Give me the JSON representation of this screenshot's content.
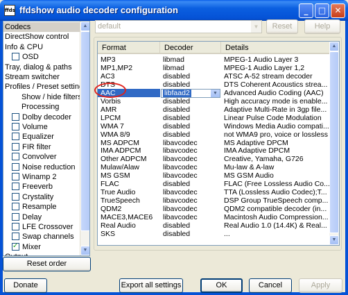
{
  "window": {
    "title": "ffdshow audio decoder configuration",
    "icon_label": "ffds"
  },
  "titlebar_buttons": {
    "minimize": "_",
    "maximize": "□",
    "close": "✕"
  },
  "tree": {
    "items": [
      {
        "label": "Codecs",
        "selected": true
      },
      {
        "label": "DirectShow control"
      },
      {
        "label": "Info & CPU"
      },
      {
        "label": "OSD",
        "checkbox": true,
        "checked": false
      },
      {
        "label": "Tray, dialog & paths"
      },
      {
        "label": "Stream switcher"
      },
      {
        "label": "Profiles / Preset settings"
      },
      {
        "label": "Show / hide filters"
      },
      {
        "label": "Processing"
      },
      {
        "label": "Dolby decoder",
        "checkbox": true,
        "checked": false
      },
      {
        "label": "Volume",
        "checkbox": true,
        "checked": false
      },
      {
        "label": "Equalizer",
        "checkbox": true,
        "checked": false
      },
      {
        "label": "FIR filter",
        "checkbox": true,
        "checked": false
      },
      {
        "label": "Convolver",
        "checkbox": true,
        "checked": false
      },
      {
        "label": "Noise reduction",
        "checkbox": true,
        "checked": false
      },
      {
        "label": "Winamp 2",
        "checkbox": true,
        "checked": false
      },
      {
        "label": "Freeverb",
        "checkbox": true,
        "checked": false
      },
      {
        "label": "Crystality",
        "checkbox": true,
        "checked": false
      },
      {
        "label": "Resample",
        "checkbox": true,
        "checked": false
      },
      {
        "label": "Delay",
        "checkbox": true,
        "checked": false
      },
      {
        "label": "LFE Crossover",
        "checkbox": true,
        "checked": false
      },
      {
        "label": "Swap channels",
        "checkbox": true,
        "checked": false
      },
      {
        "label": "Mixer",
        "checkbox": true,
        "checked": true
      },
      {
        "label": "Output"
      }
    ]
  },
  "preset": {
    "value": "default",
    "reset_label": "Reset",
    "help_label": "Help"
  },
  "codecs_table": {
    "headers": [
      "Format",
      "Decoder",
      "Details"
    ],
    "rows": [
      [
        "MP3",
        "libmad",
        "MPEG-1 Audio Layer 3"
      ],
      [
        "MP1,MP2",
        "libmad",
        "MPEG-1 Audio Layer 1,2"
      ],
      [
        "AC3",
        "disabled",
        "ATSC A-52 stream decoder"
      ],
      [
        "DTS",
        "disabled",
        "DTS Coherent Acoustics strea..."
      ],
      [
        "AAC",
        "libfaad2",
        "Advanced Audio Coding (AAC)"
      ],
      [
        "Vorbis",
        "disabled",
        "High accuracy mode is enable..."
      ],
      [
        "AMR",
        "disabled",
        "Adaptive Multi-Rate in 3gp file..."
      ],
      [
        "LPCM",
        "disabled",
        "Linear Pulse Code Modulation"
      ],
      [
        "WMA 7",
        "disabled",
        "Windows Media Audio compati..."
      ],
      [
        "WMA 8/9",
        "disabled",
        "not WMA9 pro, voice or lossless"
      ],
      [
        "MS ADPCM",
        "libavcodec",
        "MS Adaptive DPCM"
      ],
      [
        "IMA ADPCM",
        "libavcodec",
        "IMA Adaptive DPCM"
      ],
      [
        "Other ADPCM",
        "libavcodec",
        "Creative, Yamaha, G726"
      ],
      [
        "Mulaw/Alaw",
        "libavcodec",
        "Mu-law & A-law"
      ],
      [
        "MS GSM",
        "libavcodec",
        "MS GSM Audio"
      ],
      [
        "FLAC",
        "disabled",
        "FLAC (Free Lossless Audio Co..."
      ],
      [
        "True Audio",
        "libavcodec",
        "TTA (Lossless Audio Codec);T..."
      ],
      [
        "TrueSpeech",
        "libavcodec",
        "DSP Group TrueSpeech comp..."
      ],
      [
        "QDM2",
        "libavcodec",
        "QDM2 compatible decoder (in..."
      ],
      [
        "MACE3,MACE6",
        "libavcodec",
        "Macintosh Audio Compression..."
      ],
      [
        "Real Audio",
        "disabled",
        "Real Audio 1.0 (14.4K) & Real..."
      ],
      [
        "SKS",
        "disabled",
        "..."
      ]
    ],
    "selected_row": 4,
    "decoder_dropdown_value": "libfaad2"
  },
  "bottom": {
    "reset_order_label": "Reset order",
    "donate_label": "Donate",
    "export_label": "Export all settings",
    "ok_label": "OK",
    "cancel_label": "Cancel",
    "apply_label": "Apply"
  },
  "colors": {
    "titlebar": "#0552d6",
    "selection": "#316ac5",
    "annotation": "#e0201a"
  }
}
